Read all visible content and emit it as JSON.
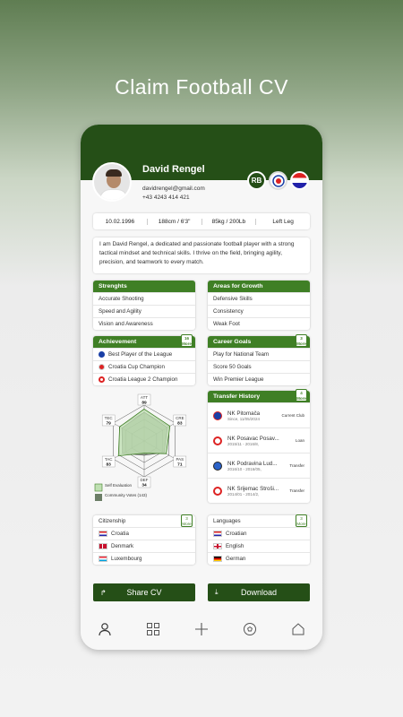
{
  "screen_title": "Claim Football CV",
  "profile": {
    "name": "David Rengel",
    "email": "davidrengel@gmail.com",
    "phone": "+43 4243 414 421",
    "club_badge": "RB",
    "stats": [
      "10.02.1996",
      "188cm / 6'3\"",
      "85kg / 200Lb",
      "Left Leg"
    ],
    "bio": "I am David Rengel, a dedicated and passionate football player with a strong tactical mindset and technical skills. I thrive on the field, bringing agility, precision, and teamwork to every match."
  },
  "strengths": {
    "title": "Strenghts",
    "items": [
      "Accurate Shooting",
      "Speed and Agility",
      "Vision and Awareness"
    ]
  },
  "growth": {
    "title": "Areas for Growth",
    "items": [
      "Defensive Skills",
      "Consistency",
      "Weak Foot"
    ]
  },
  "achievement": {
    "title": "Achievement",
    "count": "16",
    "more": "More",
    "items": [
      "Best Player of the League",
      "Croatia Cup Champion",
      "Croatia League 2 Champion"
    ]
  },
  "goals": {
    "title": "Career Goals",
    "count": "3",
    "more": "More",
    "items": [
      "Play for National Team",
      "Score 50 Goals",
      "Win Premier League"
    ]
  },
  "radar": {
    "labels": [
      {
        "name": "ATT",
        "value": "89"
      },
      {
        "name": "CRE",
        "value": "83"
      },
      {
        "name": "PAS",
        "value": "71"
      },
      {
        "name": "DEF",
        "value": "34"
      },
      {
        "name": "TAC",
        "value": "83"
      },
      {
        "name": "TEC",
        "value": "79"
      }
    ],
    "self_values": [
      89,
      83,
      71,
      34,
      83,
      79
    ],
    "community_values": [
      80,
      75,
      65,
      40,
      70,
      72
    ],
    "legend_self": "Self Evaluation",
    "legend_community": "Community Votes (143)"
  },
  "transfers": {
    "title": "Transfer History",
    "count": "4",
    "more": "More",
    "items": [
      {
        "club": "NK Pitomača",
        "date": "Since, 11/05/2024",
        "status": "Current Club"
      },
      {
        "club": "NK Posavac Posav...",
        "date": "2015/11 - 2016/8,",
        "status": "Loan"
      },
      {
        "club": "NK Podravina Lud...",
        "date": "2016/10 - 2016/05,",
        "status": "Transfer"
      },
      {
        "club": "NK Srijemac Stroši...",
        "date": "2014/01 - 2014/2,",
        "status": "Transfer"
      }
    ]
  },
  "citizenship": {
    "title": "Citizenship",
    "count": "3",
    "more": "More",
    "items": [
      "Croatia",
      "Denmark",
      "Luxembourg"
    ]
  },
  "languages": {
    "title": "Languages",
    "count": "3",
    "more": "More",
    "items": [
      "Croatian",
      "English",
      "German"
    ]
  },
  "actions": {
    "share": "Share CV",
    "download": "Download"
  },
  "colors": {
    "header": "#254f17",
    "accent": "#3f7f25"
  }
}
